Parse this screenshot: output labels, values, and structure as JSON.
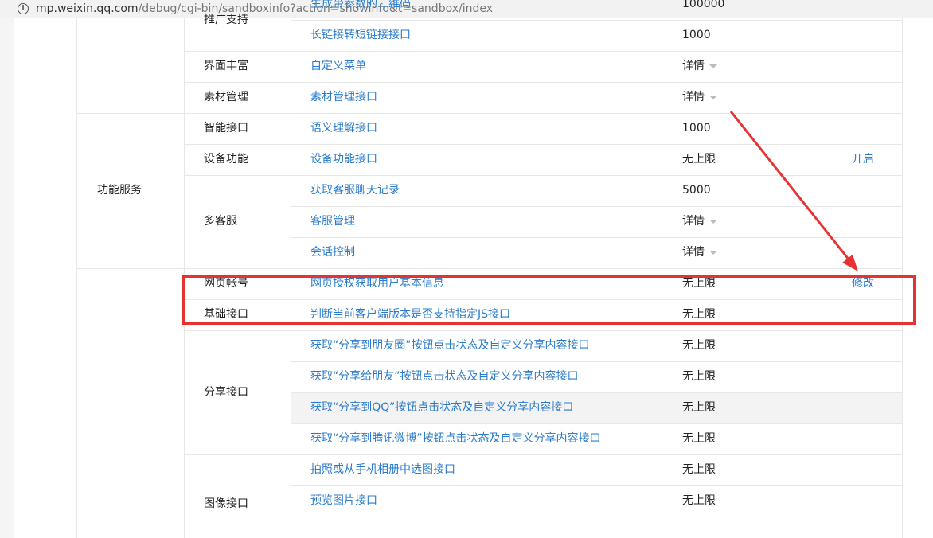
{
  "address_bar": {
    "host": "mp.weixin.qq.com",
    "path": "/debug/cgi-bin/sandboxinfo?action=showinfo&t=sandbox/index"
  },
  "table": {
    "group_service": "功能服务",
    "rows": [
      {
        "category": "推广支持",
        "name": "生成带参数的二维码",
        "limit": "100000",
        "op": ""
      },
      {
        "category": "",
        "name": "长链接转短链接接口",
        "limit": "1000",
        "op": ""
      },
      {
        "category": "界面丰富",
        "name": "自定义菜单",
        "limit": "详情",
        "op": ""
      },
      {
        "category": "素材管理",
        "name": "素材管理接口",
        "limit": "详情",
        "op": ""
      },
      {
        "category": "智能接口",
        "name": "语义理解接口",
        "limit": "1000",
        "op": ""
      },
      {
        "category": "设备功能",
        "name": "设备功能接口",
        "limit": "无上限",
        "op": "开启"
      },
      {
        "category": "多客服",
        "name": "获取客服聊天记录",
        "limit": "5000",
        "op": ""
      },
      {
        "category": "",
        "name": "客服管理",
        "limit": "详情",
        "op": ""
      },
      {
        "category": "",
        "name": "会话控制",
        "limit": "详情",
        "op": ""
      },
      {
        "category": "网页帐号",
        "name": "网页授权获取用户基本信息",
        "limit": "无上限",
        "op": "修改"
      },
      {
        "category": "基础接口",
        "name": "判断当前客户端版本是否支持指定JS接口",
        "limit": "无上限",
        "op": ""
      },
      {
        "category": "分享接口",
        "name": "获取“分享到朋友圈”按钮点击状态及自定义分享内容接口",
        "limit": "无上限",
        "op": ""
      },
      {
        "category": "",
        "name": "获取“分享给朋友”按钮点击状态及自定义分享内容接口",
        "limit": "无上限",
        "op": ""
      },
      {
        "category": "",
        "name": "获取“分享到QQ”按钮点击状态及自定义分享内容接口",
        "limit": "无上限",
        "op": ""
      },
      {
        "category": "",
        "name": "获取“分享到腾讯微博”按钮点击状态及自定义分享内容接口",
        "limit": "无上限",
        "op": ""
      },
      {
        "category": "图像接口",
        "name": "拍照或从手机相册中选图接口",
        "limit": "无上限",
        "op": ""
      },
      {
        "category": "",
        "name": "预览图片接口",
        "limit": "无上限",
        "op": ""
      }
    ]
  },
  "colors": {
    "link": "#2a7bcb",
    "highlight_box": "#e53333",
    "arrow": "#e53333"
  }
}
